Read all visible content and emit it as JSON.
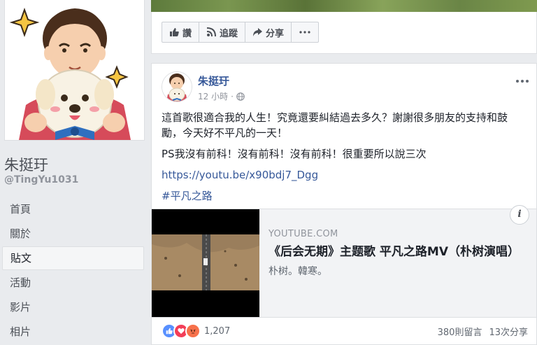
{
  "page": {
    "name": "朱挺玗",
    "handle": "@TingYu1031"
  },
  "nav": {
    "items": [
      {
        "label": "首頁"
      },
      {
        "label": "關於"
      },
      {
        "label": "貼文",
        "active": true
      },
      {
        "label": "活動"
      },
      {
        "label": "影片"
      },
      {
        "label": "相片"
      }
    ]
  },
  "actions": {
    "like": "讚",
    "follow": "追蹤",
    "share": "分享",
    "more_icon": "ellipsis-icon"
  },
  "post": {
    "author": "朱挺玗",
    "time": "12 小時",
    "separator": "·",
    "privacy_icon": "globe-icon",
    "text_line1": "這首歌很適合我的人生！究竟還要糾結過去多久？謝謝很多朋友的支持和鼓勵，今天好不平凡的一天！",
    "text_line2": "PS我沒有前科！沒有前科！沒有前科！很重要所以說三次",
    "link": "https://youtu.be/x90bdj7_Dgg",
    "hashtag": "#平凡之路",
    "preview": {
      "domain": "YOUTUBE.COM",
      "title": "《后会无期》主题歌 平凡之路MV（朴树演唱）",
      "description": "朴树。韓寒。",
      "info_icon": "i"
    },
    "reactions": {
      "count": "1,207",
      "types": [
        "like",
        "love",
        "angry"
      ]
    },
    "comments": "380則留言",
    "shares": "13次分享"
  },
  "colors": {
    "link": "#365899",
    "like": "#5890ff",
    "love": "#f33e58",
    "angry": "#f7714b"
  }
}
